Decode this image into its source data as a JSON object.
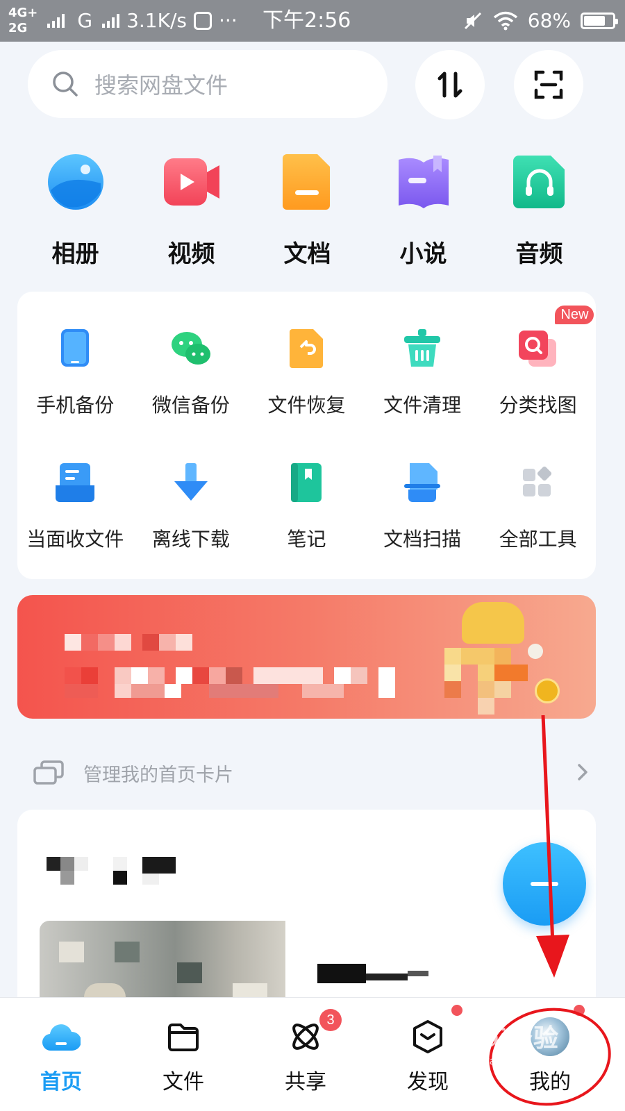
{
  "status_bar": {
    "net_top": "4G+",
    "net_bottom": "2G",
    "net2": "G",
    "speed": "3.1K/s",
    "dots": "···",
    "time": "下午2:56",
    "battery": "68%"
  },
  "search": {
    "placeholder": "搜索网盘文件"
  },
  "categories": [
    {
      "label": "相册",
      "icon": "album-icon"
    },
    {
      "label": "视频",
      "icon": "video-icon"
    },
    {
      "label": "文档",
      "icon": "document-icon"
    },
    {
      "label": "小说",
      "icon": "novel-icon"
    },
    {
      "label": "音频",
      "icon": "audio-icon"
    }
  ],
  "tools": [
    {
      "label": "手机备份",
      "icon": "phone-backup-icon"
    },
    {
      "label": "微信备份",
      "icon": "wechat-backup-icon"
    },
    {
      "label": "文件恢复",
      "icon": "file-recovery-icon"
    },
    {
      "label": "文件清理",
      "icon": "file-cleanup-icon"
    },
    {
      "label": "分类找图",
      "icon": "image-search-icon",
      "badge": "New"
    },
    {
      "label": "当面收文件",
      "icon": "receive-file-icon"
    },
    {
      "label": "离线下载",
      "icon": "offline-download-icon"
    },
    {
      "label": "笔记",
      "icon": "notes-icon"
    },
    {
      "label": "文档扫描",
      "icon": "doc-scan-icon"
    },
    {
      "label": "全部工具",
      "icon": "all-tools-icon"
    }
  ],
  "manage_cards": {
    "label": "管理我的首页卡片"
  },
  "bottom_nav": [
    {
      "label": "首页",
      "icon": "home-cloud-icon",
      "active": true
    },
    {
      "label": "文件",
      "icon": "folder-icon"
    },
    {
      "label": "共享",
      "icon": "share-atom-icon",
      "badge": "3"
    },
    {
      "label": "发现",
      "icon": "discover-box-icon",
      "dot": true
    },
    {
      "label": "我的",
      "icon": "avatar",
      "dot": true
    }
  ],
  "watermark": {
    "title": "Bai经验",
    "sub": "jingyan.baidu.com"
  },
  "colors": {
    "accent": "#1a9cf4",
    "badge": "#f2545b",
    "annotation": "#e8161c"
  }
}
